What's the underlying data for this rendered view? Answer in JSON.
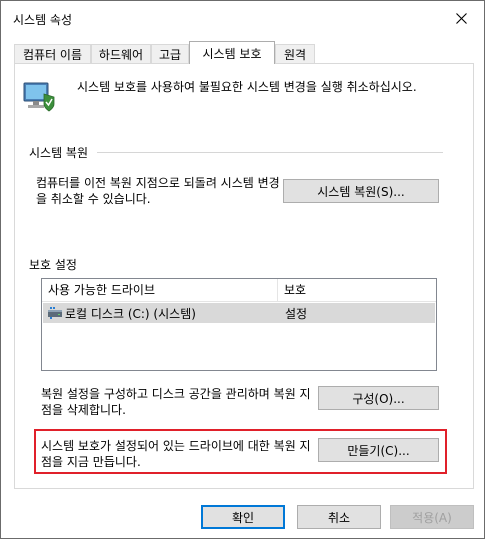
{
  "window": {
    "title": "시스템 속성"
  },
  "tabs": [
    {
      "label": "컴퓨터 이름"
    },
    {
      "label": "하드웨어"
    },
    {
      "label": "고급"
    },
    {
      "label": "시스템 보호",
      "active": true
    },
    {
      "label": "원격"
    }
  ],
  "header": {
    "icon": "system-protection-icon",
    "text": "시스템 보호를 사용하여 불필요한 시스템 변경을 실행 취소하십시오."
  },
  "restore": {
    "section_title": "시스템 복원",
    "description": "컴퓨터를 이전 복원 지점으로 되돌려 시스템 변경을 취소할 수 있습니다.",
    "button_label": "시스템 복원(S)..."
  },
  "protection": {
    "section_title": "보호 설정",
    "columns": [
      "사용 가능한 드라이브",
      "보호"
    ],
    "rows": [
      {
        "drive": "로컬 디스크 (C:) (시스템)",
        "status": "설정",
        "icon": "drive-icon"
      }
    ],
    "configure_text": "복원 설정을 구성하고 디스크 공간을 관리하며 복원 지점을 삭제합니다.",
    "configure_button": "구성(O)...",
    "create_text": "시스템 보호가 설정되어 있는 드라이브에 대한 복원 지점을 지금 만듭니다.",
    "create_button": "만들기(C)..."
  },
  "footer": {
    "ok": "확인",
    "cancel": "취소",
    "apply": "적용(A)"
  },
  "colors": {
    "highlight": "#e0202a",
    "default_button_border": "#0078d7"
  }
}
